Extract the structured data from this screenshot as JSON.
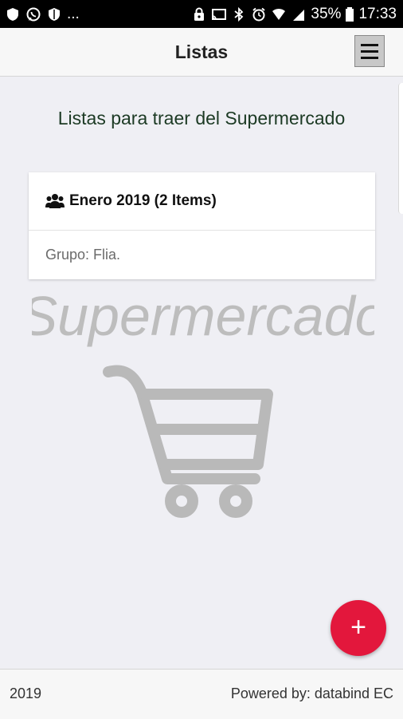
{
  "status_bar": {
    "left_icons": [
      "shield-icon",
      "whatsapp-icon",
      "shield-check-icon"
    ],
    "ellipsis": "...",
    "right_icons": [
      "lock-icon",
      "cast-icon",
      "bluetooth-icon",
      "alarm-icon",
      "wifi-icon",
      "signal-icon",
      "battery-icon"
    ],
    "battery": "35%",
    "time": "17:33"
  },
  "header": {
    "title": "Listas",
    "menu_icon": "hamburger-menu-icon"
  },
  "subtitle": "Listas para traer del Supermercado",
  "lists": [
    {
      "icon": "users-icon",
      "title": "Enero 2019 (2 Items)",
      "group": "Grupo: Flia."
    }
  ],
  "background_logo": {
    "text": "Supermercado",
    "icon": "shopping-cart-icon"
  },
  "fab": {
    "label": "+",
    "color": "#e3173c"
  },
  "footer": {
    "year": "2019",
    "powered": "Powered by: databind EC"
  }
}
